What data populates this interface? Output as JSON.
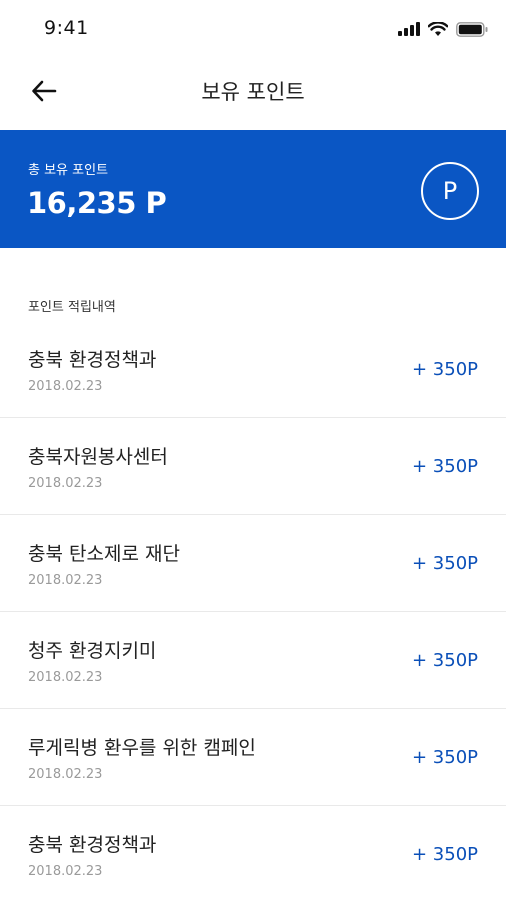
{
  "status_bar": {
    "time": "9:41"
  },
  "header": {
    "title": "보유 포인트",
    "back_icon": "arrow-left-icon"
  },
  "summary": {
    "label": "총 보유 포인트",
    "value": "16,235 P",
    "badge": "P",
    "accent_color": "#0a56c4"
  },
  "history": {
    "title": "포인트 적립내역",
    "amount_color": "#0a4fb8",
    "items": [
      {
        "name": "충북 환경정책과",
        "date": "2018.02.23",
        "amount": "+ 350P"
      },
      {
        "name": "충북자원봉사센터",
        "date": "2018.02.23",
        "amount": "+ 350P"
      },
      {
        "name": "충북 탄소제로 재단",
        "date": "2018.02.23",
        "amount": "+ 350P"
      },
      {
        "name": "청주 환경지키미",
        "date": "2018.02.23",
        "amount": "+ 350P"
      },
      {
        "name": "루게릭병 환우를 위한 캠페인",
        "date": "2018.02.23",
        "amount": "+ 350P"
      },
      {
        "name": "충북 환경정책과",
        "date": "2018.02.23",
        "amount": "+ 350P"
      }
    ]
  }
}
